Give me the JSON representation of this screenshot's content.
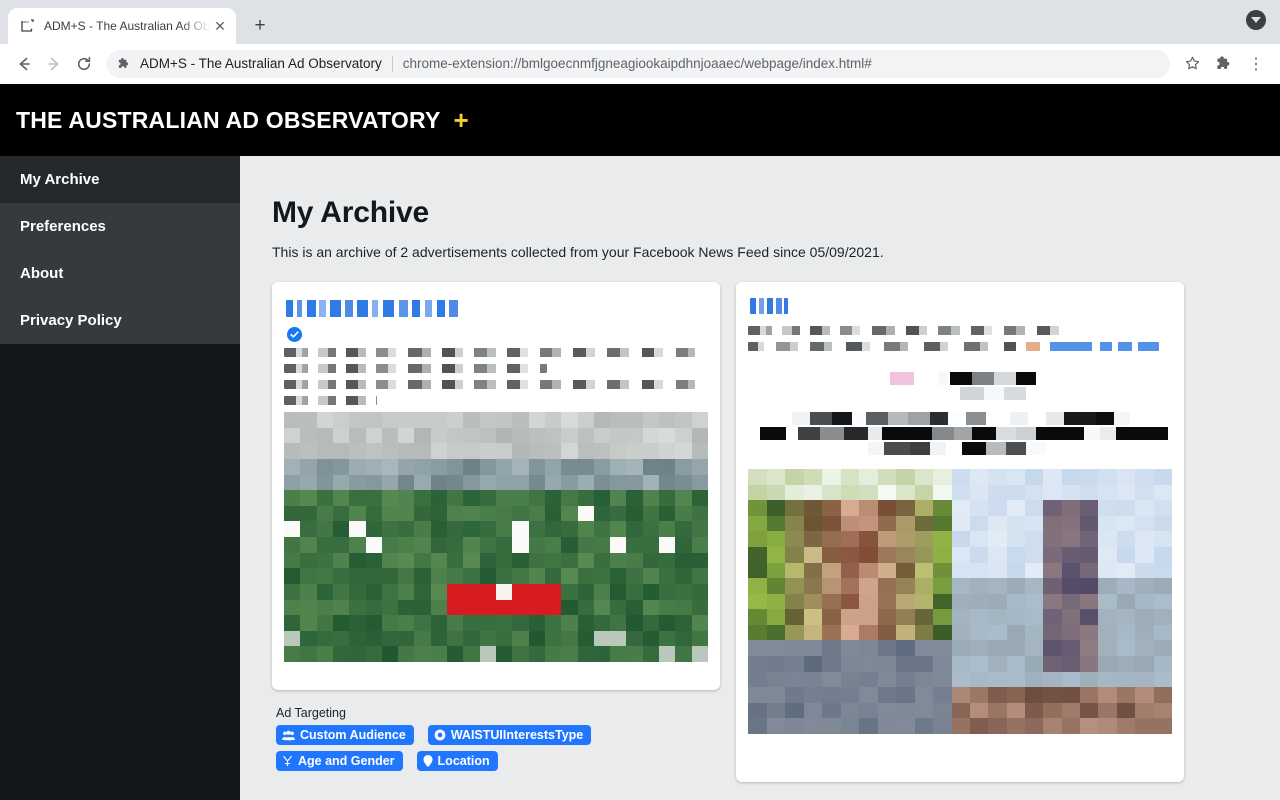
{
  "browser": {
    "tab": {
      "title": "ADM+S - The Australian Ad Ob",
      "favicon_name": "adms-logo-icon",
      "close_label": "✕"
    },
    "new_tab_label": "+",
    "toolbar": {
      "back_label": "←",
      "forward_label": "→",
      "reload_label": "↻",
      "omnibox_extension_name": "ADM+S - The Australian Ad Observatory",
      "omnibox_url": "chrome-extension://bmlgoecnmfjgneagiookaipdhnjoaaec/webpage/index.html#",
      "bookmark_label": "☆",
      "extensions_label": "puzzle",
      "menu_label": "⋮"
    },
    "downloads_chip_name": "downloads-chevron-icon"
  },
  "brand": {
    "title": "THE AUSTRALIAN AD OBSERVATORY",
    "plus": "+",
    "plus_color": "#f4ce2c",
    "background": "#000000"
  },
  "sidebar": {
    "items": [
      {
        "label": "My Archive",
        "active": true
      },
      {
        "label": "Preferences",
        "active": false
      },
      {
        "label": "About",
        "active": false
      },
      {
        "label": "Privacy Policy",
        "active": false
      }
    ]
  },
  "main": {
    "title": "My Archive",
    "description": "This is an archive of 2 advertisements collected from your Facebook News Feed since 05/09/2021.",
    "ad_count": 2,
    "collected_from": "Facebook News Feed",
    "since_date": "05/09/2021",
    "accent_blue": "#2176ff",
    "background": "#e9ebec"
  },
  "ads": [
    {
      "advertiser_redacted": true,
      "verified_badge": true,
      "verified_badge_color": "#1877f2",
      "body_redacted": true,
      "image_redacted": true,
      "targeting": {
        "label": "Ad Targeting",
        "tags": [
          {
            "label": "Custom Audience",
            "icon": "people-icon"
          },
          {
            "label": "WAISTUIInterestsType",
            "icon": "record-circle-icon"
          },
          {
            "label": "Age and Gender",
            "icon": "gender-icon"
          },
          {
            "label": "Location",
            "icon": "map-pin-icon"
          }
        ]
      }
    },
    {
      "advertiser_redacted": true,
      "verified_badge": false,
      "body_redacted": true,
      "image_redacted": true,
      "targeting": null
    }
  ]
}
